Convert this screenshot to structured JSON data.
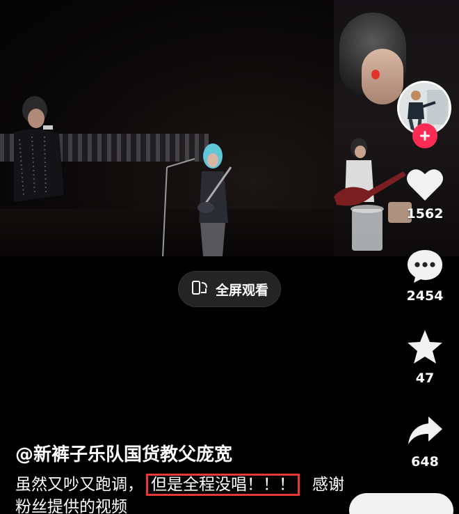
{
  "video": {
    "fullscreen_label": "全屏观看"
  },
  "rail": {
    "like_count": "1562",
    "comment_count": "2454",
    "favorite_count": "47",
    "share_count": "648"
  },
  "post": {
    "author": "@新裤子乐队国货教父庞宽",
    "caption_start": "虽然又吵又跑调，",
    "caption_highlight": "但是全程没唱！！！",
    "caption_end": "感谢",
    "caption_line2": "粉丝提供的视频"
  },
  "colors": {
    "follow_button": "#fe2c55",
    "highlight_box": "#e53935",
    "background": "#000000"
  }
}
